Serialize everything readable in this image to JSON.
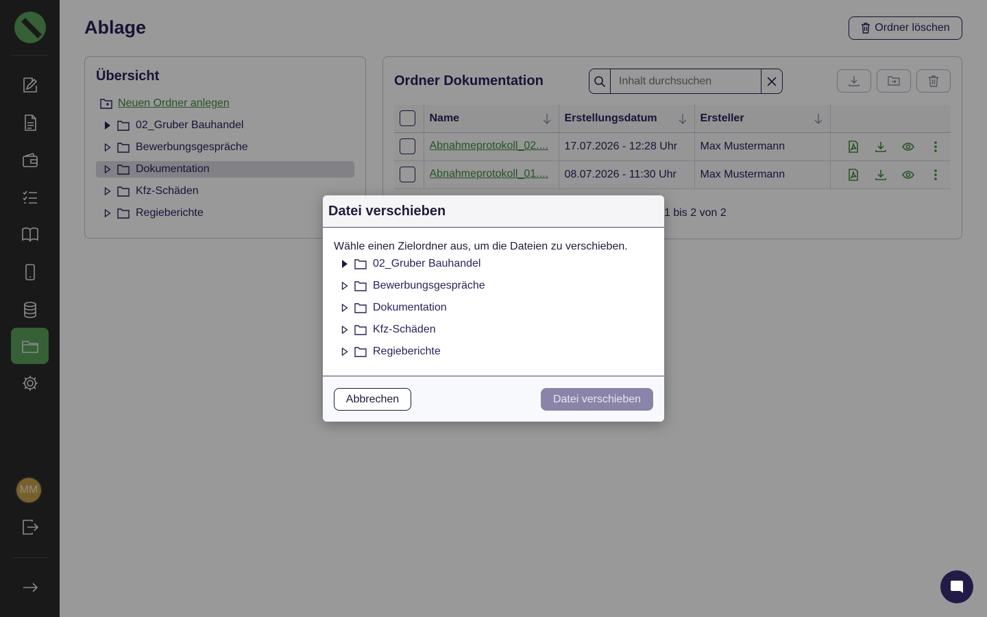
{
  "sidebar": {
    "items": [
      {
        "icon": "edit-document-icon"
      },
      {
        "icon": "document-icon"
      },
      {
        "icon": "wallet-icon"
      },
      {
        "icon": "checklist-icon"
      },
      {
        "icon": "book-icon"
      },
      {
        "icon": "mobile-icon"
      },
      {
        "icon": "database-icon"
      },
      {
        "icon": "folder-icon",
        "active": true
      },
      {
        "icon": "gear-icon"
      }
    ],
    "user_initials": "MM",
    "accent_color": "#5aa05a"
  },
  "page": {
    "title": "Ablage",
    "delete_folder_label": "Ordner löschen"
  },
  "overview": {
    "title": "Übersicht",
    "new_folder_label": "Neuen Ordner anlegen",
    "folders": [
      {
        "name": "02_Gruber Bauhandel",
        "expanded": true
      },
      {
        "name": "Bewerbungsgespräche"
      },
      {
        "name": "Dokumentation",
        "selected": true
      },
      {
        "name": "Kfz-Schäden"
      },
      {
        "name": "Regieberichte"
      }
    ]
  },
  "folder_panel": {
    "title": "Ordner Dokumentation",
    "search_placeholder": "Inhalt durchsuchen",
    "columns": [
      "Name",
      "Erstellungsdatum",
      "Ersteller"
    ],
    "rows": [
      {
        "name": "Abnahmeprotokoll_02....",
        "date": "17.07.2026 - 12:28 Uhr",
        "creator": "Max Mustermann"
      },
      {
        "name": "Abnahmeprotokoll_01....",
        "date": "08.07.2026 - 11:30 Uhr",
        "creator": "Max Mustermann"
      }
    ],
    "pagination": "1 bis 2 von 2"
  },
  "modal": {
    "title": "Datei verschieben",
    "intro": "Wähle einen Zielordner aus, um die Dateien zu verschieben.",
    "folders": [
      {
        "name": "02_Gruber Bauhandel",
        "expanded": true
      },
      {
        "name": "Bewerbungsgespräche"
      },
      {
        "name": "Dokumentation"
      },
      {
        "name": "Kfz-Schäden"
      },
      {
        "name": "Regieberichte"
      }
    ],
    "cancel_label": "Abbrechen",
    "confirm_label": "Datei verschieben"
  }
}
